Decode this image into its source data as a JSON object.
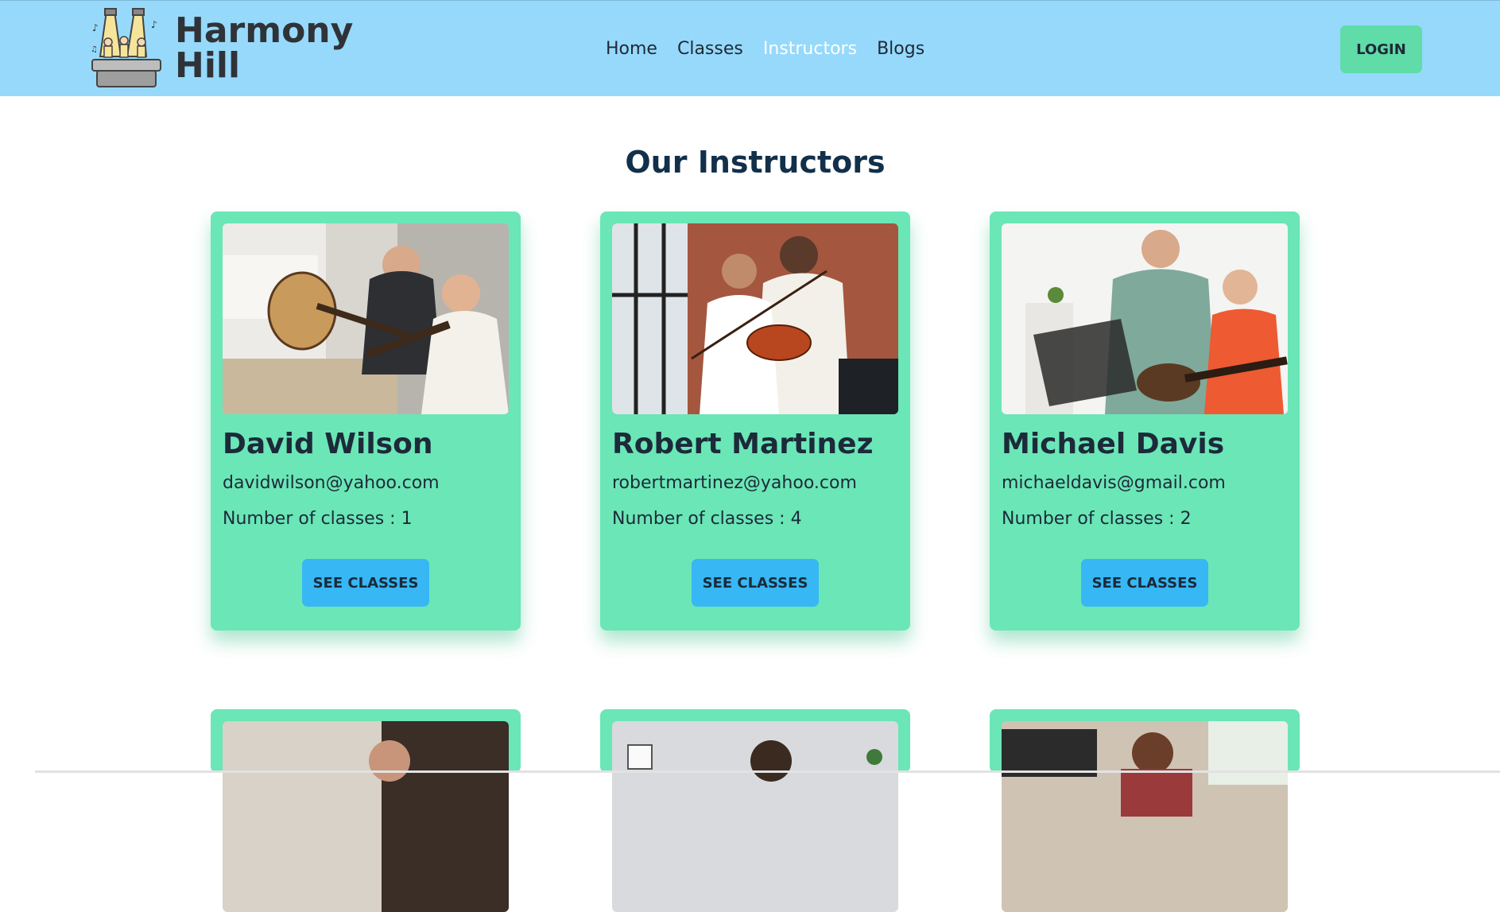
{
  "brand": {
    "name": "Harmony Hill",
    "logo_icon": "concert-stage-icon"
  },
  "nav": {
    "links": [
      {
        "label": "Home",
        "active": false
      },
      {
        "label": "Classes",
        "active": false
      },
      {
        "label": "Instructors",
        "active": true
      },
      {
        "label": "Blogs",
        "active": false
      }
    ],
    "login_label": "LOGIN"
  },
  "page": {
    "title": "Our Instructors"
  },
  "instructors": [
    {
      "name": "David Wilson",
      "email": "davidwilson@yahoo.com",
      "classes_text": "Number of classes : 1",
      "button": "SEE CLASSES",
      "photo": "guitar-lesson-photo"
    },
    {
      "name": "Robert Martinez",
      "email": "robertmartinez@yahoo.com",
      "classes_text": "Number of classes : 4",
      "button": "SEE CLASSES",
      "photo": "violin-lesson-photo"
    },
    {
      "name": "Michael Davis",
      "email": "michaeldavis@gmail.com",
      "classes_text": "Number of classes : 2",
      "button": "SEE CLASSES",
      "photo": "electric-guitar-lesson-photo"
    }
  ],
  "colors": {
    "navbar": "#96d9fb",
    "accent_green": "#6be6b6",
    "login_green": "#5fdca8",
    "button_blue": "#37b7f4",
    "title": "#12304a"
  }
}
